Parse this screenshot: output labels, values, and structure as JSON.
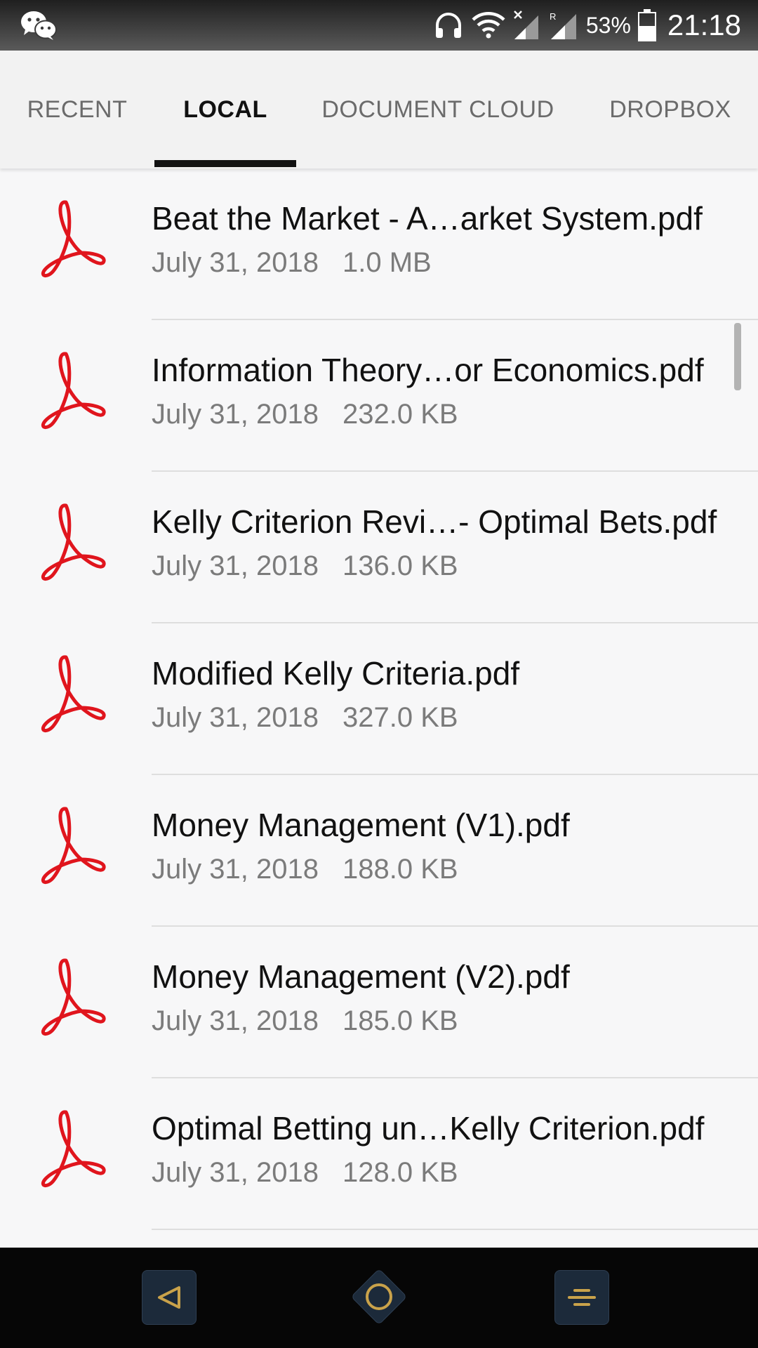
{
  "status_bar": {
    "battery_percent": "53%",
    "time": "21:18",
    "signal_label": "R",
    "icons": [
      "wechat-icon",
      "headphones-icon",
      "wifi-icon",
      "signal-x-icon",
      "signal-r-icon",
      "battery-icon"
    ]
  },
  "tabs": [
    {
      "label": "RECENT",
      "active": false
    },
    {
      "label": "LOCAL",
      "active": true
    },
    {
      "label": "DOCUMENT CLOUD",
      "active": false
    },
    {
      "label": "DROPBOX",
      "active": false
    }
  ],
  "files": [
    {
      "name": "Beat the Market - A…arket System.pdf",
      "date": "July 31, 2018",
      "size": "1.0 MB"
    },
    {
      "name": "Information Theory…or Economics.pdf",
      "date": "July 31, 2018",
      "size": "232.0 KB"
    },
    {
      "name": "Kelly Criterion Revi…- Optimal Bets.pdf",
      "date": "July 31, 2018",
      "size": "136.0 KB"
    },
    {
      "name": "Modified Kelly Criteria.pdf",
      "date": "July 31, 2018",
      "size": "327.0 KB"
    },
    {
      "name": "Money Management (V1).pdf",
      "date": "July 31, 2018",
      "size": "188.0 KB"
    },
    {
      "name": "Money Management (V2).pdf",
      "date": "July 31, 2018",
      "size": "185.0 KB"
    },
    {
      "name": "Optimal Betting un…Kelly Criterion.pdf",
      "date": "July 31, 2018",
      "size": "128.0 KB"
    }
  ],
  "nav_bar": {
    "icons": [
      "back-icon",
      "home-icon",
      "menu-icon"
    ]
  },
  "colors": {
    "pdf_red": "#e0151d",
    "nav_gold": "#c9a24a",
    "text_primary": "#111111",
    "text_secondary": "#7b7b7b"
  }
}
